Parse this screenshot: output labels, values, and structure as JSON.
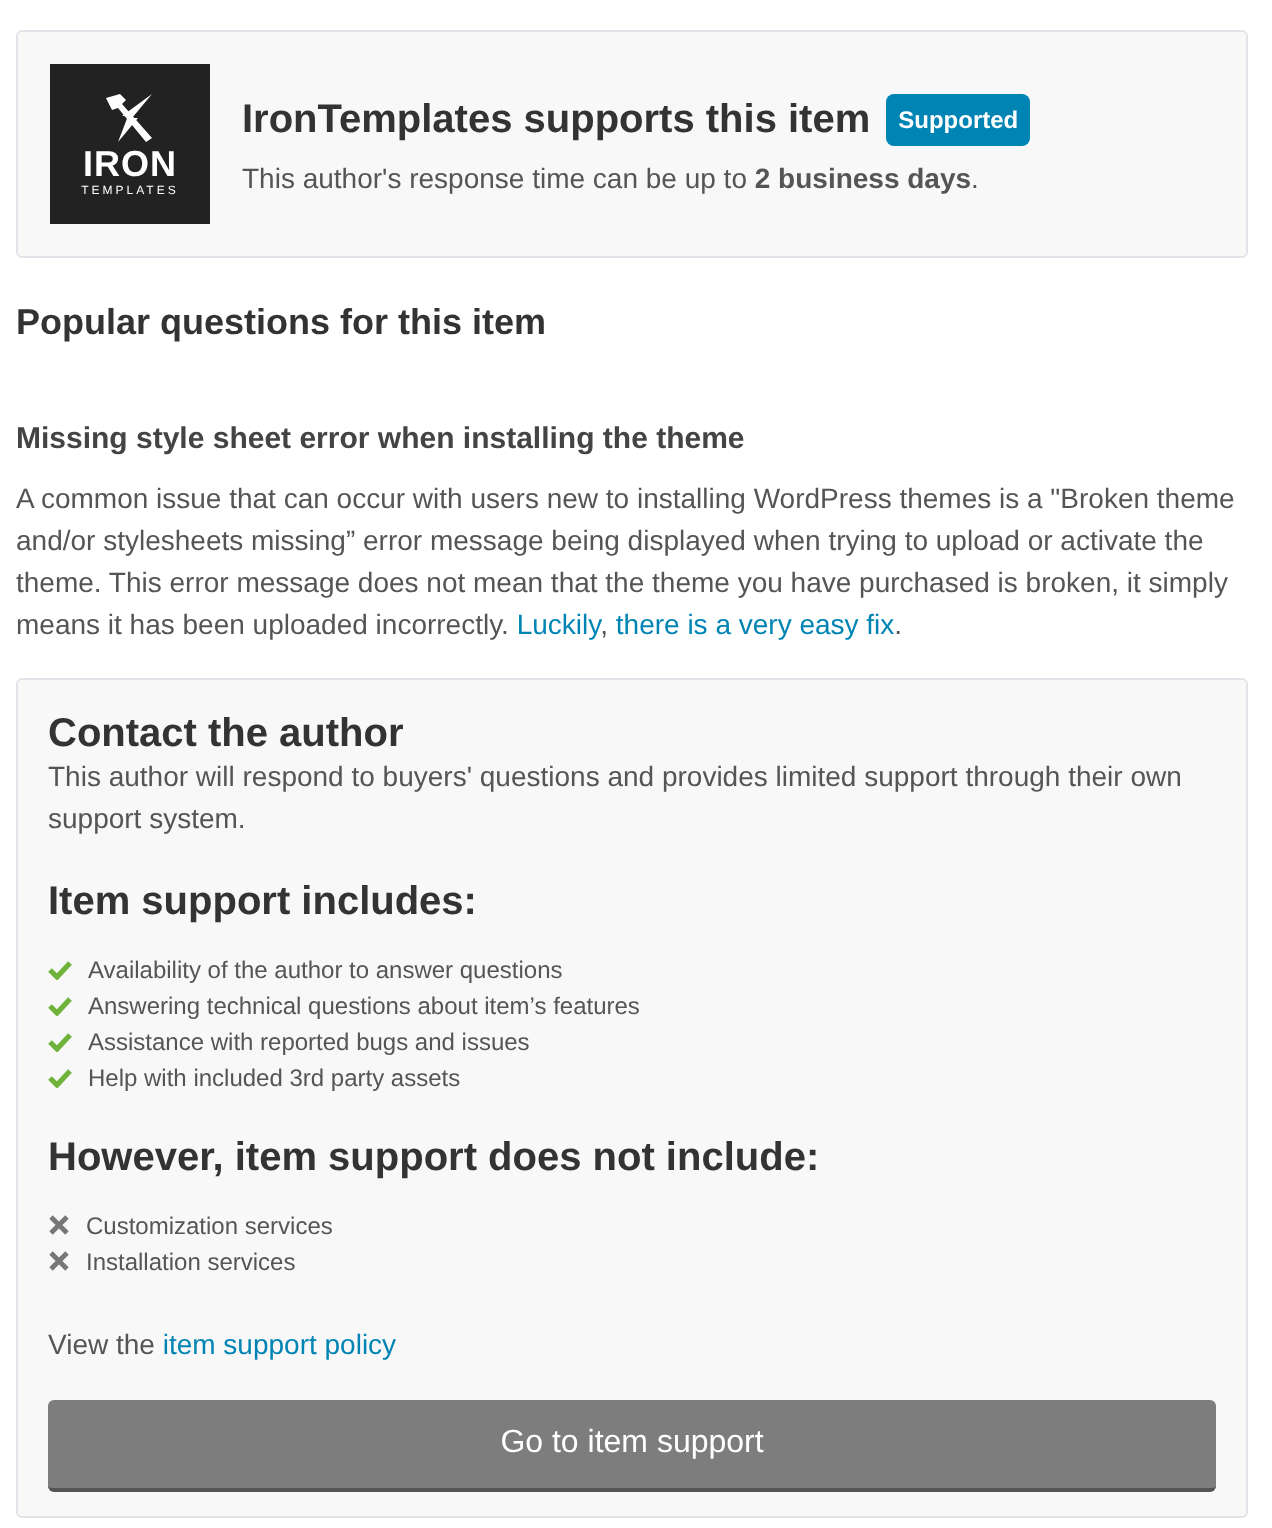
{
  "support_card": {
    "logo": {
      "title": "IRON",
      "subtitle": "TEMPLATES"
    },
    "title": "IronTemplates supports this item",
    "badge": "Supported",
    "note": "This author's response time can be up to **2 business days**."
  },
  "popular": {
    "heading": "Popular questions for this item",
    "question": "Missing style sheet error when installing the theme",
    "answer": [
      {
        "kind": "text",
        "text": "A common issue that can occur with users new to installing WordPress themes is a \"Broken theme and/or stylesheets missing” error message being displayed when trying to upload or activate the theme. This error message does not mean that the theme you have purchased is broken, it simply means it has been uploaded incorrectly. "
      },
      {
        "kind": "link",
        "text": "Luckily"
      },
      {
        "kind": "text",
        "text": ", "
      },
      {
        "kind": "link",
        "text": "there is a very easy fix"
      },
      {
        "kind": "text",
        "text": "."
      }
    ]
  },
  "contact": {
    "title": "Contact the author",
    "description": "This author will respond to buyers' questions and provides limited support through their own support system.",
    "lists": [
      {
        "heading": "Item support includes:",
        "kind": "included",
        "items": [
          "Availability of the author to answer questions",
          "Answering technical questions about item’s features",
          "Assistance with reported bugs and issues",
          "Help with included 3rd party assets"
        ]
      },
      {
        "heading": "However, item support does not include:",
        "kind": "excluded",
        "items": [
          "Customization services",
          "Installation services"
        ]
      }
    ],
    "policy_prefix": "View the",
    "policy_link": "item support policy",
    "button": "Go to item support"
  }
}
